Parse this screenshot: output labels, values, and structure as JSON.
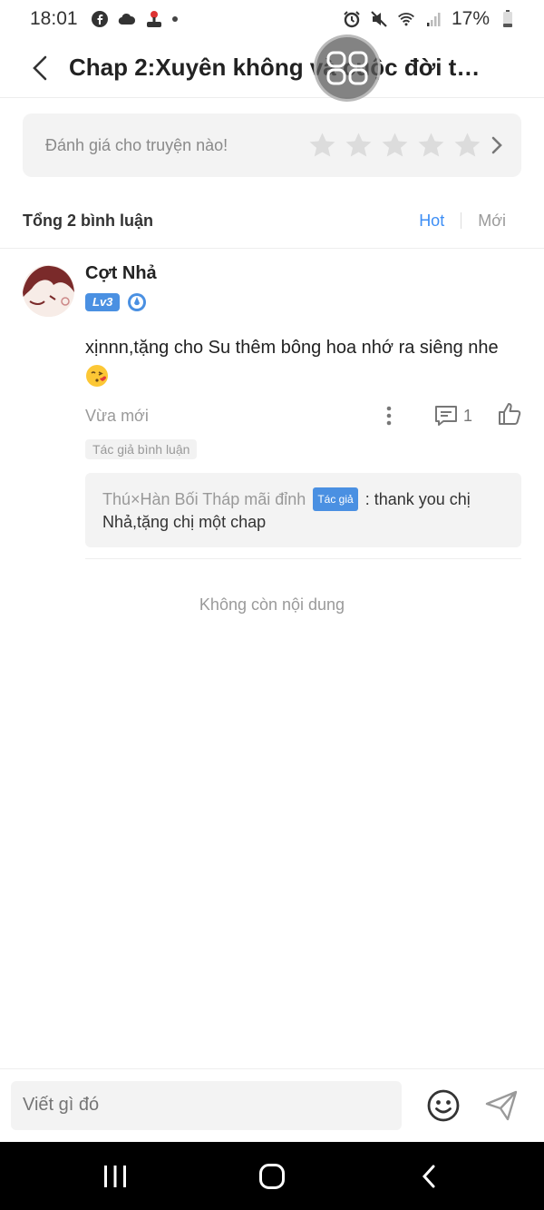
{
  "status_bar": {
    "time": "18:01",
    "battery": "17%",
    "icons": [
      "facebook-icon",
      "cloud-icon",
      "game-icon",
      "alarm-icon",
      "mute-icon",
      "wifi-icon",
      "signal-icon",
      "battery-icon"
    ]
  },
  "header": {
    "title": "Chap 2:Xuyên không và cuộc đời tà..."
  },
  "rating": {
    "prompt": "Đánh giá cho truyện nào!",
    "star_count": 5
  },
  "comments_summary": {
    "total_label": "Tổng 2 bình luận",
    "sort_hot": "Hot",
    "sort_new": "Mới"
  },
  "comment": {
    "username": "Cợt Nhả",
    "level": "Lv3",
    "text": "xịnnn,tặng cho Su thêm bông hoa nhớ ra siêng nhe",
    "time": "Vừa mới",
    "reply_count": "1",
    "author_comment_tag": "Tác giả bình luận",
    "reply": {
      "name": "Thú×Hàn Bối Tháp mãi đỉnh",
      "tag": "Tác giả",
      "text": ": thank you chị Nhả,tặng chị một chap"
    }
  },
  "end_text": "Không còn nội dung",
  "input": {
    "placeholder": "Viết gì đó"
  },
  "colors": {
    "accent": "#3d8ef5",
    "level_badge": "#4a90e2"
  }
}
